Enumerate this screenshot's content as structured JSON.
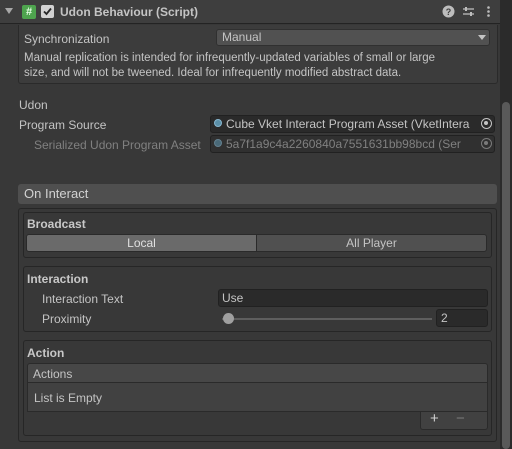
{
  "header": {
    "title": "Udon Behaviour (Script)",
    "icon_script": "#",
    "help_icon": "help-icon",
    "settings_icon": "preset-sliders-icon",
    "menu_icon": "kebab-menu-icon"
  },
  "sync": {
    "label": "Synchronization",
    "value": "Manual",
    "desc_line1": "Manual replication is intended for infrequently-updated variables of small or large",
    "desc_line2": "size, and will not be tweened. Ideal for infrequently modified abstract data."
  },
  "udon": {
    "section_label": "Udon",
    "program_source_label": "Program Source",
    "program_source_value": "Cube Vket Interact Program Asset (VketIntera",
    "serialized_label": "Serialized Udon Program Asset",
    "serialized_value": "5a7f1a9c4a2260840a7551631bb98bcd (Ser"
  },
  "on_interact": {
    "title": "On Interact",
    "broadcast": {
      "title": "Broadcast",
      "tabs": [
        "Local",
        "All Player"
      ],
      "selected": "Local"
    },
    "interaction": {
      "title": "Interaction",
      "text_label": "Interaction Text",
      "text_value": "Use",
      "proximity_label": "Proximity",
      "proximity_value": "2"
    },
    "action": {
      "title": "Action",
      "list_header": "Actions",
      "empty_text": "List is Empty",
      "add_symbol": "+",
      "remove_symbol": "−"
    }
  },
  "colors": {
    "background": "#383838",
    "script_icon": "#4ea44e",
    "selected_tab": "#6a6a6a"
  }
}
